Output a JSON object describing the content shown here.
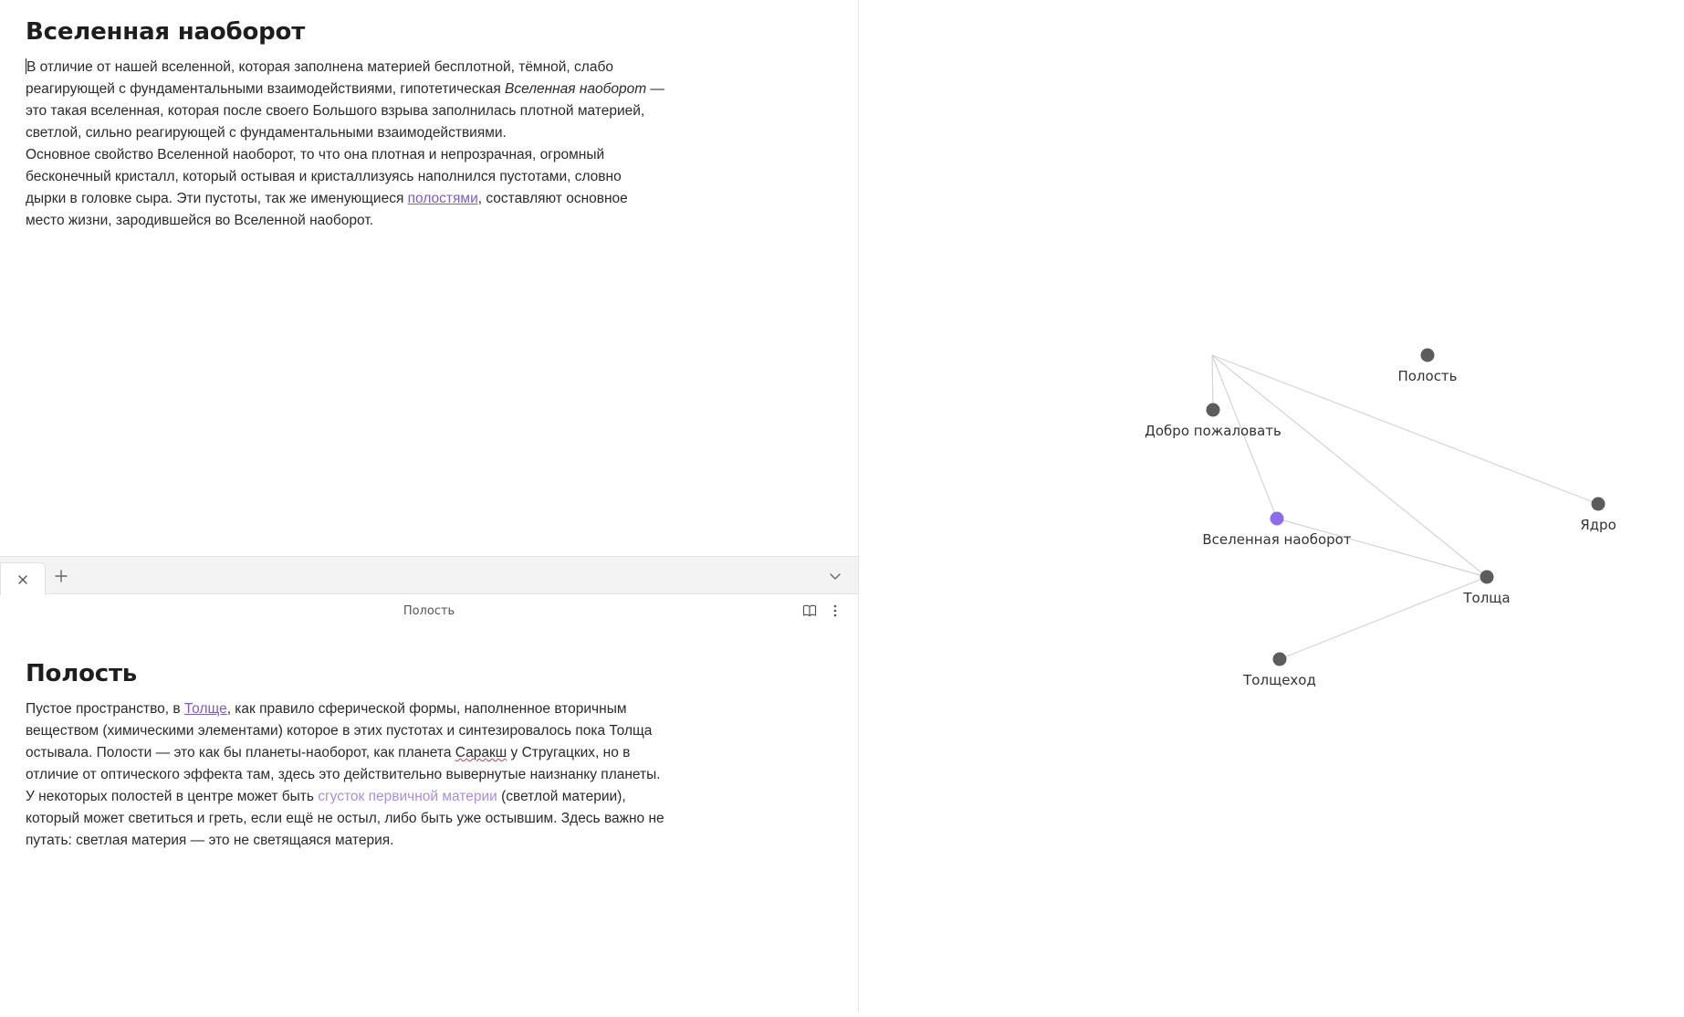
{
  "top_note": {
    "title": "Вселенная наоборот",
    "para1": {
      "a": "В отличие от нашей вселенной, которая заполнена материей бесплотной, тёмной, слабо реагирующей с фундаментальными взаимодействиями, гипотетическая ",
      "italic": "Вселенная наоборот",
      "b": " — это такая вселенная, которая после своего Большого взрыва заполнилась плотной материей, светлой, сильно реагирующей с фундаментальными взаимодействиями."
    },
    "para2": {
      "a": "Основное свойство Вселенной наоборот, то что она плотная и непрозрачная, огромный бесконечный кристалл, который остывая и кристаллизуясь наполнился пустотами, словно дырки в головке сыра. Эти пустоты, так же именующиеся ",
      "link": "полостями",
      "b": ", составляют основное место жизни, зародившейся во Вселенной наоборот."
    }
  },
  "bottom_view": {
    "header_title": "Полость",
    "note": {
      "title": "Полость",
      "para1": {
        "a": "Пустое пространство, в ",
        "link": "Толще",
        "b": ", как правило сферической формы, наполненное вторичным веществом (химическими элементами) которое в этих пустотах и синтезировалось пока Толща остывала. Полости — это как бы планеты-наоборот, как планета ",
        "spell": "Саракш",
        "c": " у Стругацких, но в отличие от оптического эффекта там, здесь это действительно вывернутые наизнанку планеты."
      },
      "para2": {
        "a": "У некоторых полостей в центре может быть ",
        "link": "сгусток первичной материи",
        "b": " (светлой материи), который может светиться и греть, если ещё не остыл, либо быть уже остывшим. Здесь важно не путать: светлая материя — это не светящаяся материя."
      }
    }
  },
  "icons": {
    "close_tab": "close-icon",
    "new_tab": "plus-icon",
    "tab_list": "chevron-down-icon",
    "reading_view": "book-open-icon",
    "more_options": "more-vertical-icon"
  },
  "graph": {
    "nodes": [
      {
        "id": "polost",
        "label": "Полость",
        "active": false
      },
      {
        "id": "dobro",
        "label": "Добро пожаловать",
        "active": false
      },
      {
        "id": "vselennaya",
        "label": "Вселенная наоборот",
        "active": true
      },
      {
        "id": "yadro",
        "label": "Ядро",
        "active": false
      },
      {
        "id": "tolshcha",
        "label": "Толща",
        "active": false
      },
      {
        "id": "tolshchehod",
        "label": "Толщеход",
        "active": false
      }
    ],
    "colors": {
      "node": "#5c5c5c",
      "active_node": "#8b6cf0",
      "edge": "#d4d4d4",
      "label": "#333333"
    }
  }
}
